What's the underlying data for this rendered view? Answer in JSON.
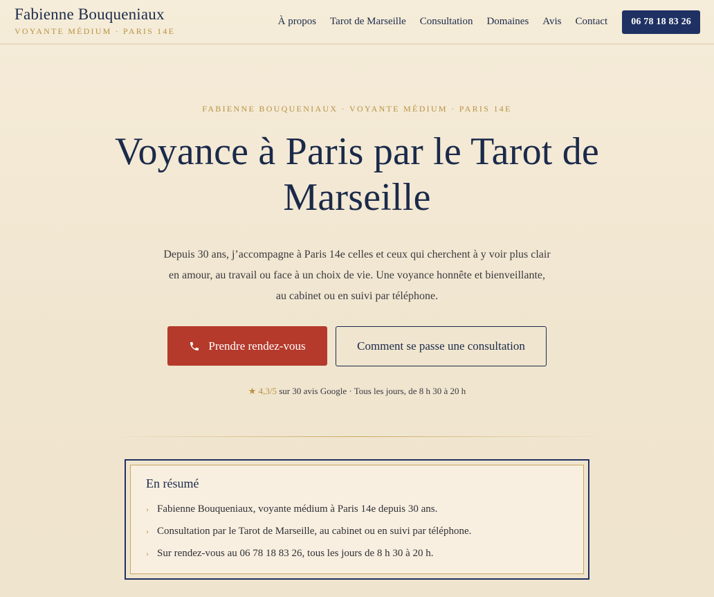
{
  "header": {
    "brand_name": "Fabienne Bouqueniaux",
    "brand_tagline": "VOYANTE MÉDIUM · PARIS 14E",
    "nav": [
      {
        "label": "À propos"
      },
      {
        "label": "Tarot de Marseille"
      },
      {
        "label": "Consultation"
      },
      {
        "label": "Domaines"
      },
      {
        "label": "Avis"
      },
      {
        "label": "Contact"
      }
    ],
    "phone": "06 78 18 83 26"
  },
  "hero": {
    "eyebrow": "FABIENNE BOUQUENIAUX · VOYANTE MÉDIUM · PARIS 14E",
    "title_line1": "Voyance à Paris par le Tarot de",
    "title_line2": "Marseille",
    "lead": "Depuis 30 ans, j’accompagne à Paris 14e celles et ceux qui cherchent à y voir plus clair en amour, au travail ou face à un choix de vie. Une voyance honnête et bienveillante, au cabinet ou en suivi par téléphone.",
    "primary_cta": "Prendre rendez-vous",
    "secondary_cta": "Comment se passe une consultation",
    "rating_stars": "★ 4,3/5",
    "rating_text": " sur 30 avis Google · Tous les jours, de 8 h 30 à 20 h"
  },
  "summary": {
    "title": "En résumé",
    "items": [
      "Fabienne Bouqueniaux, voyante médium à Paris 14e depuis 30 ans.",
      "Consultation par le Tarot de Marseille, au cabinet ou en suivi par téléphone.",
      "Sur rendez-vous au 06 78 18 83 26, tous les jours de 8 h 30 à 20 h."
    ]
  },
  "colors": {
    "navy": "#1f3163",
    "gold": "#b9923f",
    "red": "#b53a2c",
    "cream": "#f5ecd9"
  },
  "icons": {
    "phone": "phone-icon",
    "chevron": "chevron-right-icon",
    "star": "star-icon"
  }
}
